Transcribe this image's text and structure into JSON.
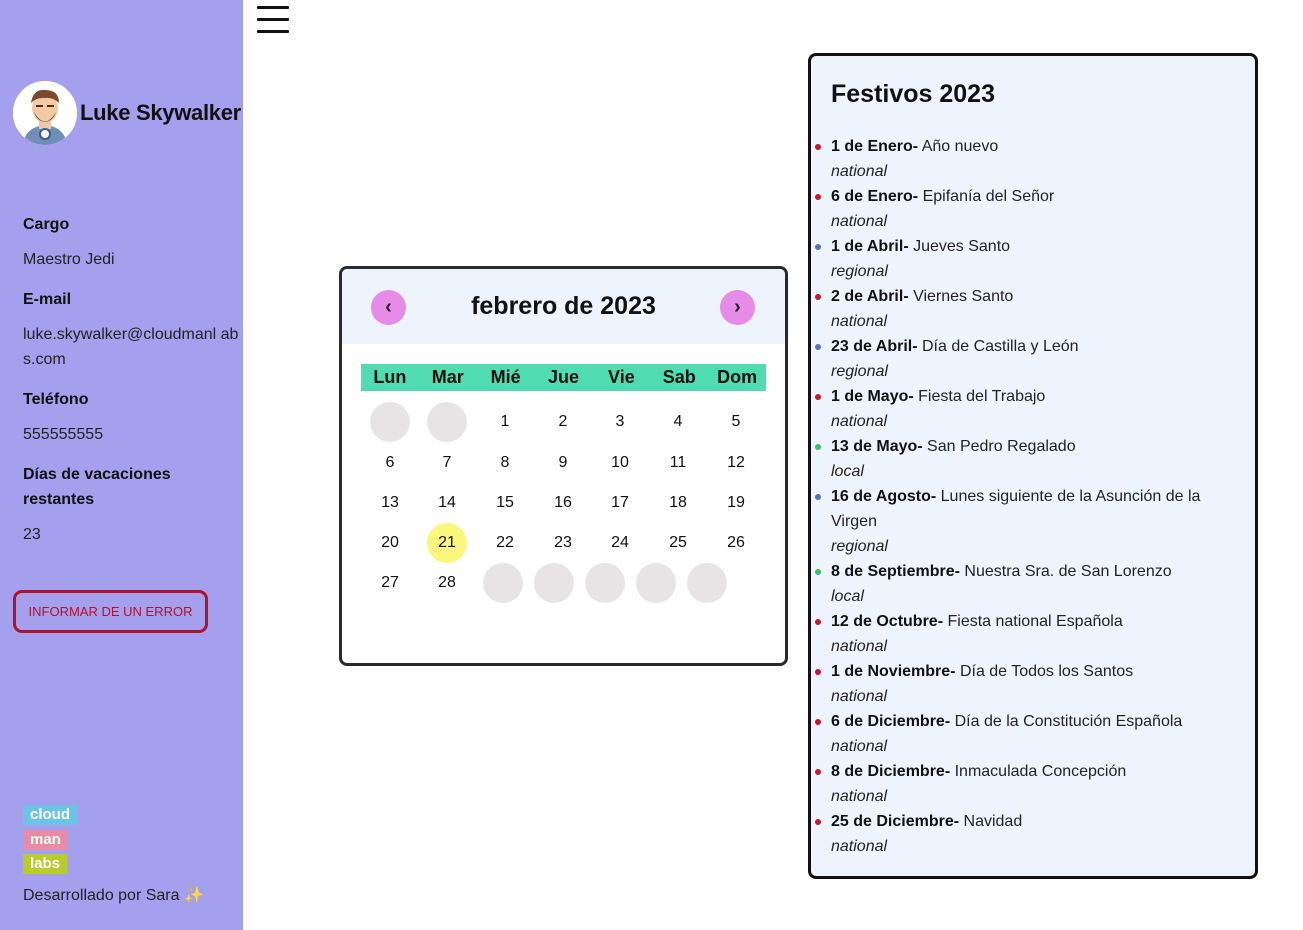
{
  "sidebar": {
    "user_name": "Luke Skywalker",
    "fields": [
      {
        "label": "Cargo",
        "value": "Maestro Jedi"
      },
      {
        "label": "E-mail",
        "value": "luke.skywalker@cloudmanl abs.com"
      },
      {
        "label": "Teléfono",
        "value": "555555555"
      },
      {
        "label": "Días de vacaciones restantes",
        "value": "23"
      }
    ],
    "report_button": "INFORMAR DE UN ERROR",
    "logo": [
      "cloud",
      "man",
      "labs"
    ],
    "credit": "Desarrollado por Sara",
    "credit_emoji": "✨"
  },
  "menu": {
    "icon": "hamburger-menu-icon"
  },
  "calendar": {
    "title": "febrero de 2023",
    "prev_icon": "‹",
    "next_icon": "›",
    "weekdays": [
      "Lun",
      "Mar",
      "Mié",
      "Jue",
      "Vie",
      "Sab",
      "Dom"
    ],
    "leading_blanks": 2,
    "days_in_month": 28,
    "trailing_blanks": 5,
    "today": 21,
    "colors": {
      "header_bg": "#eef4fd",
      "nav_button": "#e68be8",
      "weekday_bar": "#4fdcb1",
      "today": "#fbf77a",
      "blank": "#e8e4e6"
    }
  },
  "holidays": {
    "title": "Festivos 2023",
    "type_colors": {
      "national": "#d0142c",
      "regional": "#5a6fbf",
      "local": "#35c35a"
    },
    "items": [
      {
        "date": "1 de Enero-",
        "name": "Año nuevo",
        "type": "national"
      },
      {
        "date": "6 de Enero-",
        "name": "Epifanía del Señor",
        "type": "national"
      },
      {
        "date": "1 de Abril-",
        "name": "Jueves Santo",
        "type": "regional"
      },
      {
        "date": "2 de Abril-",
        "name": "Viernes Santo",
        "type": "national"
      },
      {
        "date": "23 de Abril-",
        "name": "Día de Castilla y León",
        "type": "regional"
      },
      {
        "date": "1 de Mayo-",
        "name": "Fiesta del Trabajo",
        "type": "national"
      },
      {
        "date": "13 de Mayo-",
        "name": "San Pedro Regalado",
        "type": "local"
      },
      {
        "date": "16 de Agosto-",
        "name": "Lunes siguiente de la Asunción de la Virgen",
        "type": "regional"
      },
      {
        "date": "8 de Septiembre-",
        "name": "Nuestra Sra. de San Lorenzo",
        "type": "local"
      },
      {
        "date": "12 de Octubre-",
        "name": "Fiesta national Española",
        "type": "national"
      },
      {
        "date": "1 de Noviembre-",
        "name": "Día de Todos los Santos",
        "type": "national"
      },
      {
        "date": "6 de Diciembre-",
        "name": "Día de la Constitución Española",
        "type": "national"
      },
      {
        "date": "8 de Diciembre-",
        "name": "Inmaculada Concepción",
        "type": "national"
      },
      {
        "date": "25 de Diciembre-",
        "name": "Navidad",
        "type": "national"
      }
    ]
  }
}
